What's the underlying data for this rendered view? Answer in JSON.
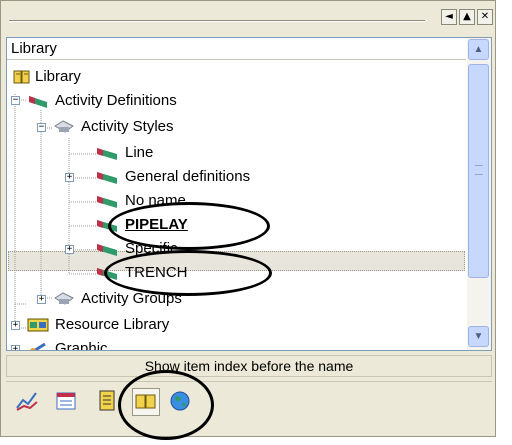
{
  "window": {
    "buttons": [
      "◄",
      "▲",
      "✕"
    ]
  },
  "tree": {
    "header": "Library",
    "items": [
      {
        "label": "Library",
        "icon": "book-icon",
        "level": 0
      },
      {
        "label": "Activity Definitions",
        "icon": "activity-flag-icon",
        "level": 1,
        "expanded": true
      },
      {
        "label": "Activity Styles",
        "icon": "folder-icon",
        "level": 2,
        "expanded": true
      },
      {
        "label": "Line",
        "icon": "activity-flag-icon",
        "level": 3
      },
      {
        "label": "General definitions",
        "icon": "activity-flag-icon",
        "level": 3,
        "collapsed": true
      },
      {
        "label": "No name",
        "icon": "activity-flag-icon",
        "level": 3
      },
      {
        "label": "PIPELAY",
        "icon": "activity-flag-icon",
        "level": 3,
        "selected": true
      },
      {
        "label": "Specific",
        "icon": "activity-flag-icon",
        "level": 3,
        "collapsed": true
      },
      {
        "label": "TRENCH",
        "icon": "activity-flag-icon",
        "level": 3
      },
      {
        "label": "Activity Groups",
        "icon": "folder-icon",
        "level": 2,
        "collapsed": true
      },
      {
        "label": "Resource Library",
        "icon": "resource-icon",
        "level": 1,
        "collapsed": true
      },
      {
        "label": "Graphic",
        "icon": "graphic-icon",
        "level": 1,
        "collapsed": true
      }
    ]
  },
  "status": {
    "text": "Show item index before the name"
  },
  "toolbar": {
    "buttons": [
      {
        "icon": "chart-icon"
      },
      {
        "icon": "calendar-icon"
      },
      {
        "icon": "document-icon"
      },
      {
        "icon": "library-book-icon",
        "active": true
      },
      {
        "icon": "globe-icon"
      }
    ]
  },
  "colors": {
    "panel": "#ece9d8",
    "accent_scroll": "#c6d8fb",
    "flag_green": "#2f9a6a",
    "flag_red": "#c0304a"
  }
}
